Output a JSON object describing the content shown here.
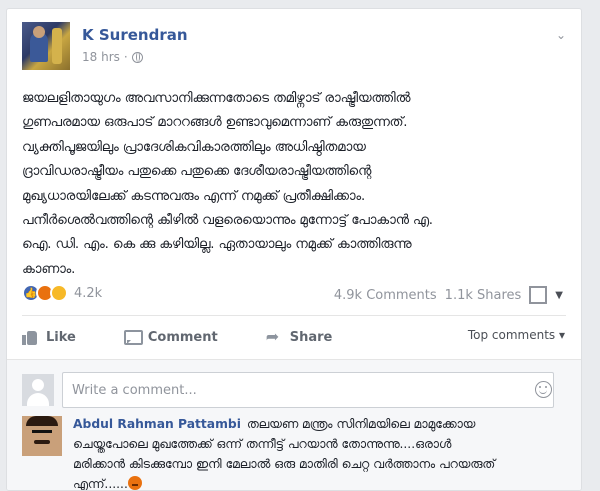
{
  "post": {
    "author": "K Surendran",
    "time": "18 hrs",
    "meta_separator": "·",
    "text_lines": [
      "ജയലളിതായുഗം അവസാനിക്കുന്നതോടെ തമിഴ്നാട് രാഷ്ട്രീയത്തിൽ",
      "ഗുണപരമായ ഒരുപാട് മാററങ്ങൾ ഉണ്ടാവുമെന്നാണ് കരുതുന്നത്.",
      "വ്യക്തിപൂജയിലും പ്രാദേശികവികാരത്തിലും അധിഷ്ഠിതമായ",
      "ദ്രാവിഡരാഷ്ട്രീയം പതുക്കെ പതുക്കെ ദേശീയരാഷ്ട്രീയത്തിന്റെ",
      "മുഖ്യധാരയിലേക്ക് കടന്നുവരും എന്ന് നമുക്ക് പ്രതീക്ഷിക്കാം.",
      "പനീർശെൽവത്തിന്റെ കീഴിൽ വളരെയൊന്നും മുന്നോട്ട് പോകാൻ എ.",
      "ഐ. ഡി. എം. കെ ക്കു കഴിയില്ല. ഏതായാലും നമുക്ക് കാത്തിരുന്നു",
      "കാണാം."
    ]
  },
  "stats": {
    "reaction_count": "4.2k",
    "comments": "4.9k Comments",
    "shares": "1.1k Shares"
  },
  "actions": {
    "like": "Like",
    "comment": "Comment",
    "share": "Share",
    "top_comments": "Top comments ▾"
  },
  "composer": {
    "placeholder": "Write a comment..."
  },
  "comment": {
    "author": "Abdul Rahman Pattambi",
    "lines": [
      "തലയണ മന്ത്രം സിനിമയിലെ മാമുക്കോയ",
      "ചെയ്തപോലെ മുഖത്തേക്ക് ഒന്ന് തന്നീട്ട് പറയാൻ തോന്നുന്നു....ഒരാൾ",
      "മരിക്കാൻ കിടക്കുമ്പോ ഇനി മേലാൽ ഒരു മാതിരി ചെറ്റ വർത്താനം പറയരുത്",
      "എന്ന്......"
    ]
  },
  "colors": {
    "link": "#365899",
    "muted": "#90949c",
    "background": "#e9ebee"
  }
}
